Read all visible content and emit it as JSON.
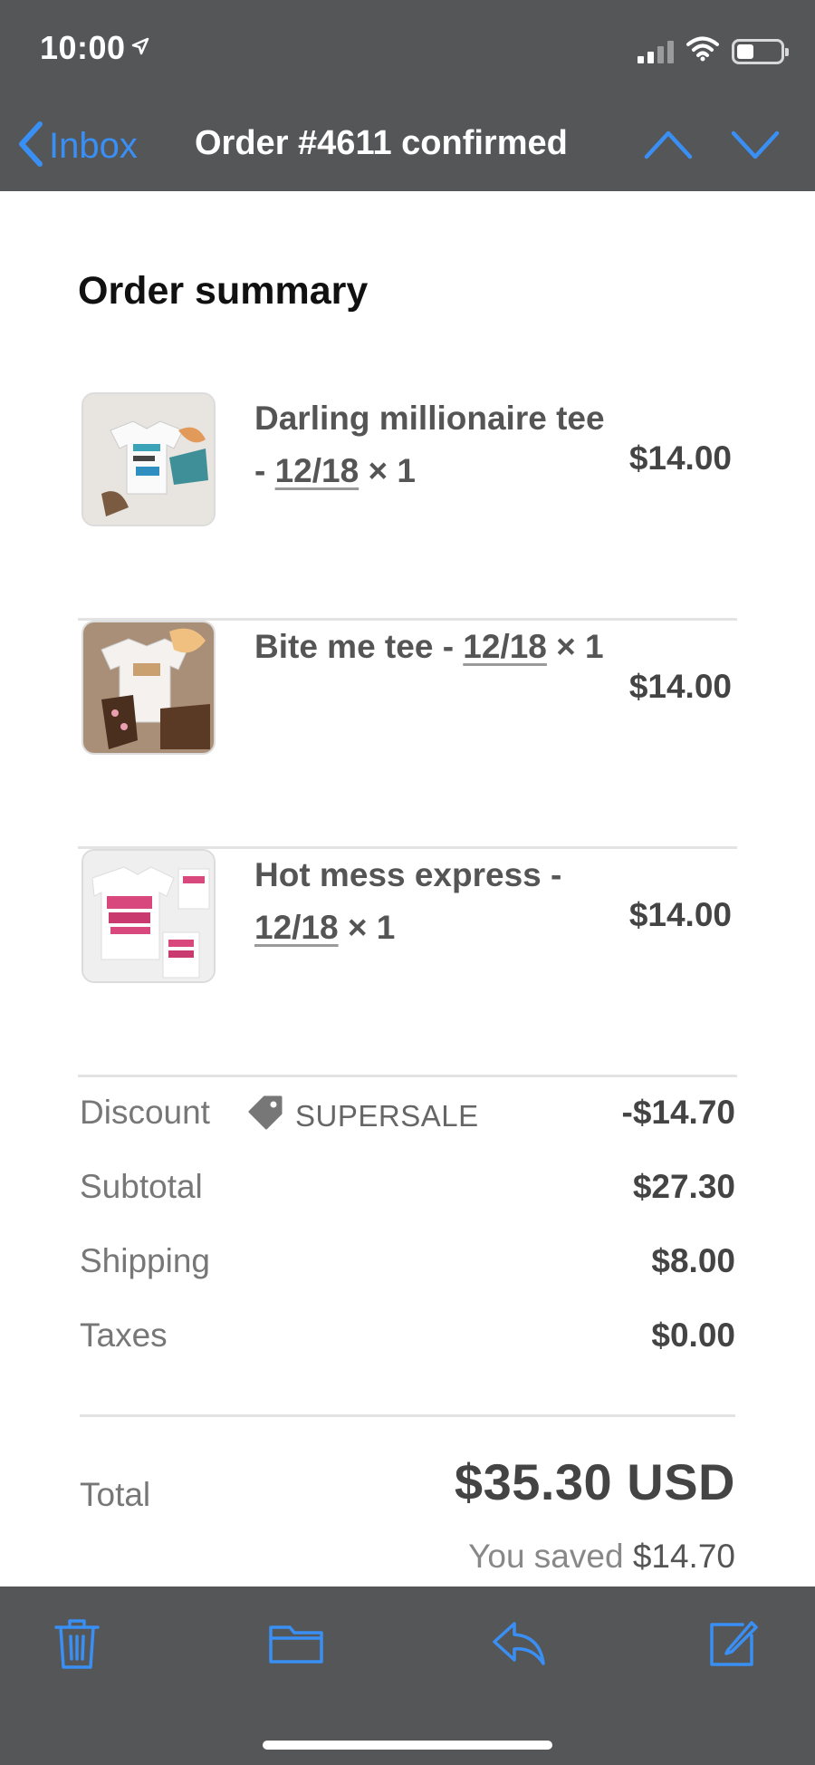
{
  "status_bar": {
    "time": "10:00",
    "battery_level": 0.4
  },
  "nav": {
    "back_label": "Inbox",
    "title": "Order #4611 confirmed"
  },
  "order": {
    "section_title": "Order summary",
    "items": [
      {
        "name": "Darling millionaire tee - ",
        "variant": "12/18",
        "qty": " × 1",
        "price": "$14.00"
      },
      {
        "name": "Bite me tee - ",
        "variant": "12/18",
        "qty": " × 1",
        "price": "$14.00"
      },
      {
        "name": "Hot mess express - ",
        "variant": "12/18",
        "qty": " × 1",
        "price": "$14.00"
      }
    ],
    "discount": {
      "label": "Discount",
      "code": "SUPERSALE",
      "value": "-$14.70"
    },
    "subtotal": {
      "label": "Subtotal",
      "value": "$27.30"
    },
    "shipping": {
      "label": "Shipping",
      "value": "$8.00"
    },
    "taxes": {
      "label": "Taxes",
      "value": "$0.00"
    },
    "total": {
      "label": "Total",
      "value": "$35.30 USD"
    },
    "saved": {
      "prefix": "You saved ",
      "amount": "$14.70"
    }
  },
  "toolbar": {
    "icons": [
      "trash-icon",
      "folder-icon",
      "reply-icon",
      "compose-icon"
    ]
  },
  "colors": {
    "accent": "#3a8ff5",
    "chrome": "#555657"
  }
}
